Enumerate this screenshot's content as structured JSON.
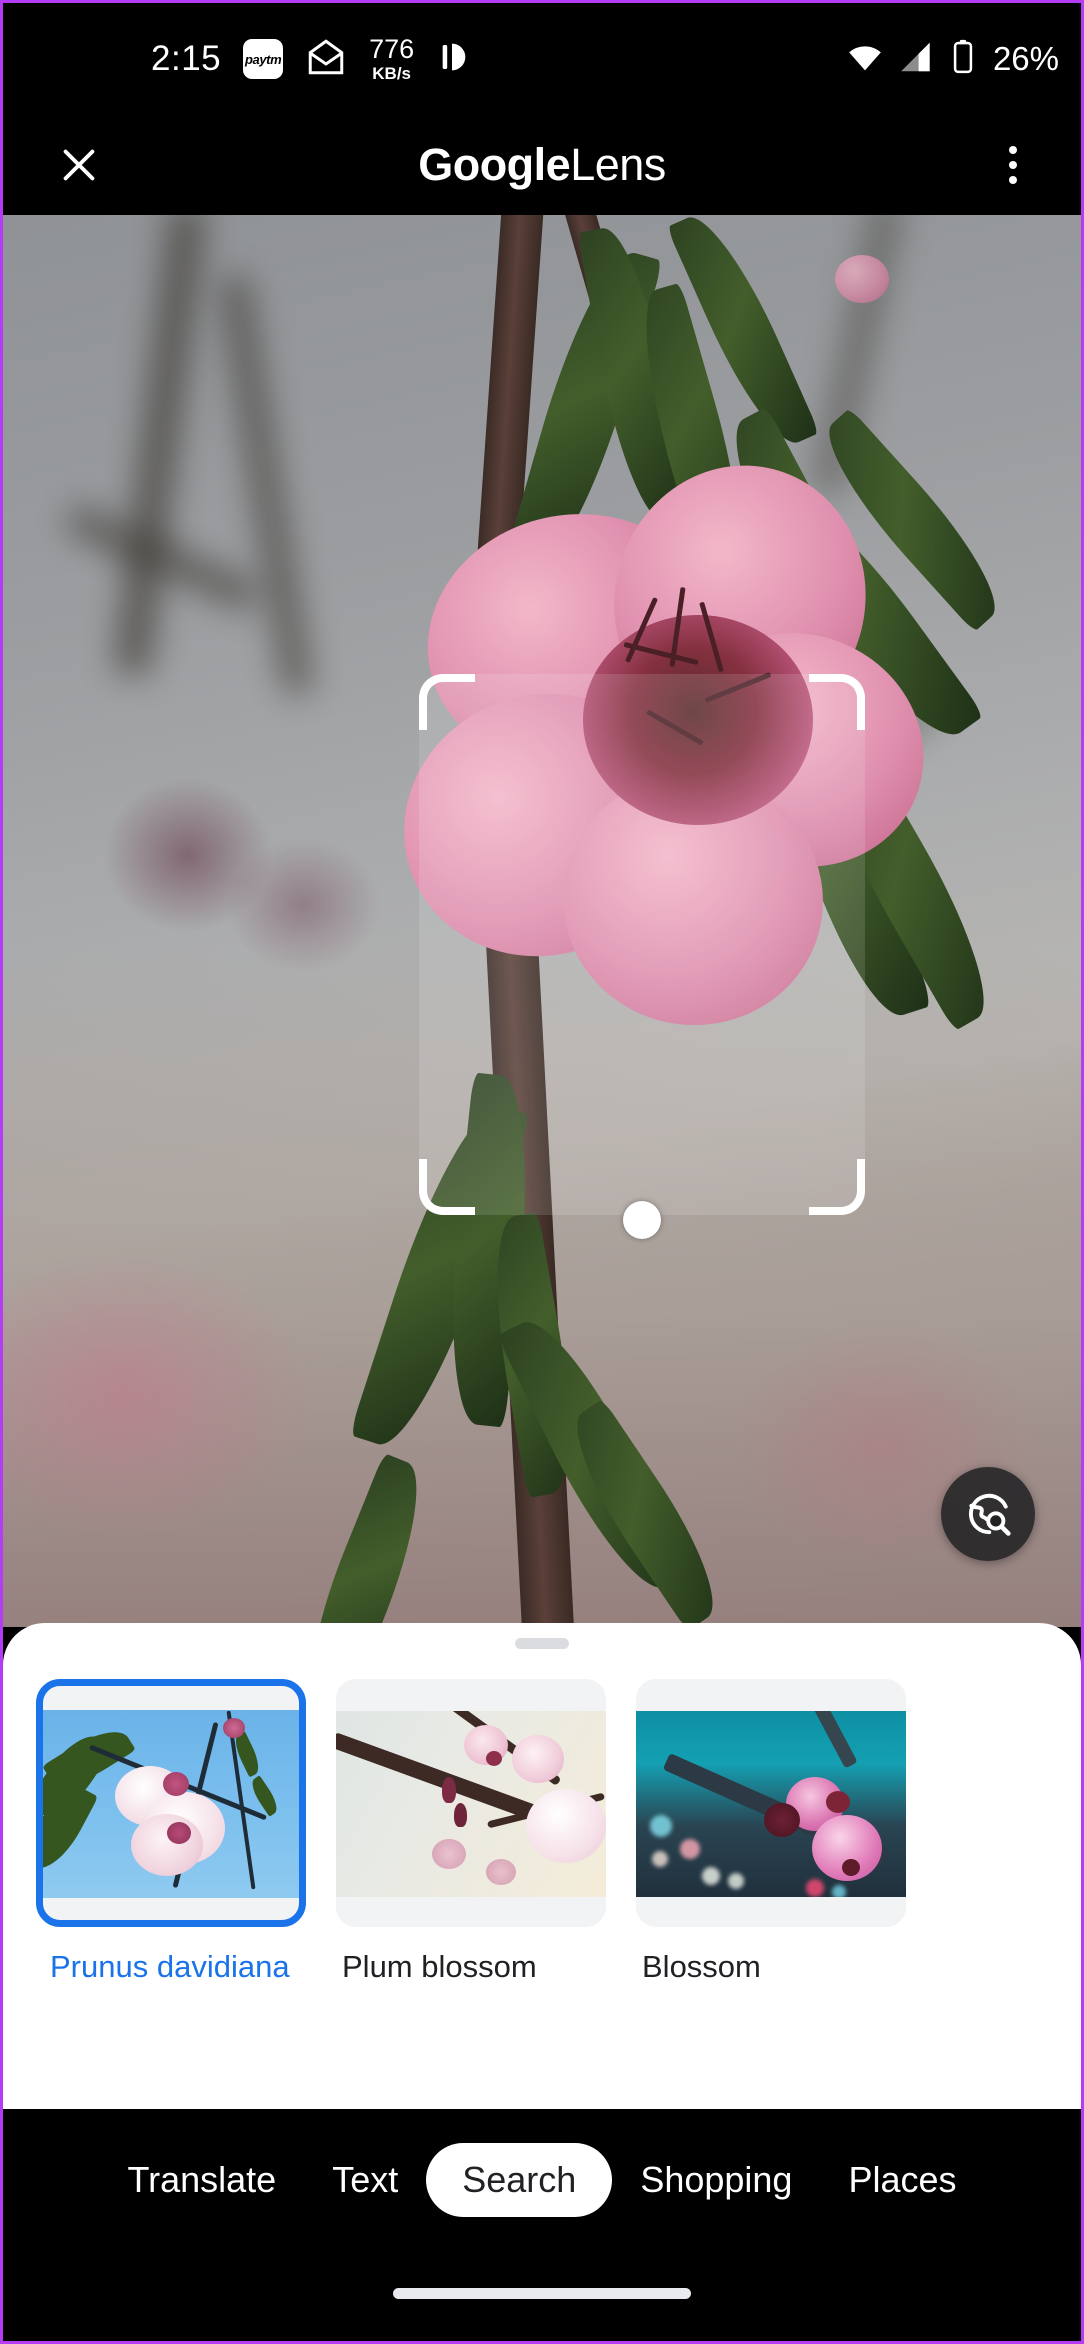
{
  "status_bar": {
    "clock": "2:15",
    "paytm_label": "paytm",
    "network_speed_value": "776",
    "network_speed_unit": "KB/s",
    "battery_percent": "26%",
    "icons": [
      "paytm-icon",
      "mail-icon",
      "network-speed-icon",
      "do-not-disturb-icon",
      "wifi-icon",
      "cellular-signal-icon",
      "battery-icon"
    ]
  },
  "app_bar": {
    "title_bold": "Google",
    "title_light": " Lens",
    "close_label": "close-icon",
    "overflow_label": "more-options-icon"
  },
  "viewfinder": {
    "fab_label": "search-the-web-icon",
    "selection_hint": "selection-frame"
  },
  "bottom_sheet": {
    "handle_label": "drag-handle",
    "results": [
      {
        "label": "Prunus davidiana",
        "selected": true
      },
      {
        "label": "Plum blossom",
        "selected": false
      },
      {
        "label": "Blossom",
        "selected": false
      }
    ]
  },
  "bottom_nav": {
    "tabs": [
      {
        "label": "Translate",
        "active": false
      },
      {
        "label": "Text",
        "active": false
      },
      {
        "label": "Search",
        "active": true
      },
      {
        "label": "Shopping",
        "active": false
      },
      {
        "label": "Places",
        "active": false
      }
    ]
  },
  "colors": {
    "accent_blue": "#1a73e8",
    "frame_border": "#b43cf5",
    "sheet_bg": "#ffffff",
    "nav_bg": "#000000"
  }
}
